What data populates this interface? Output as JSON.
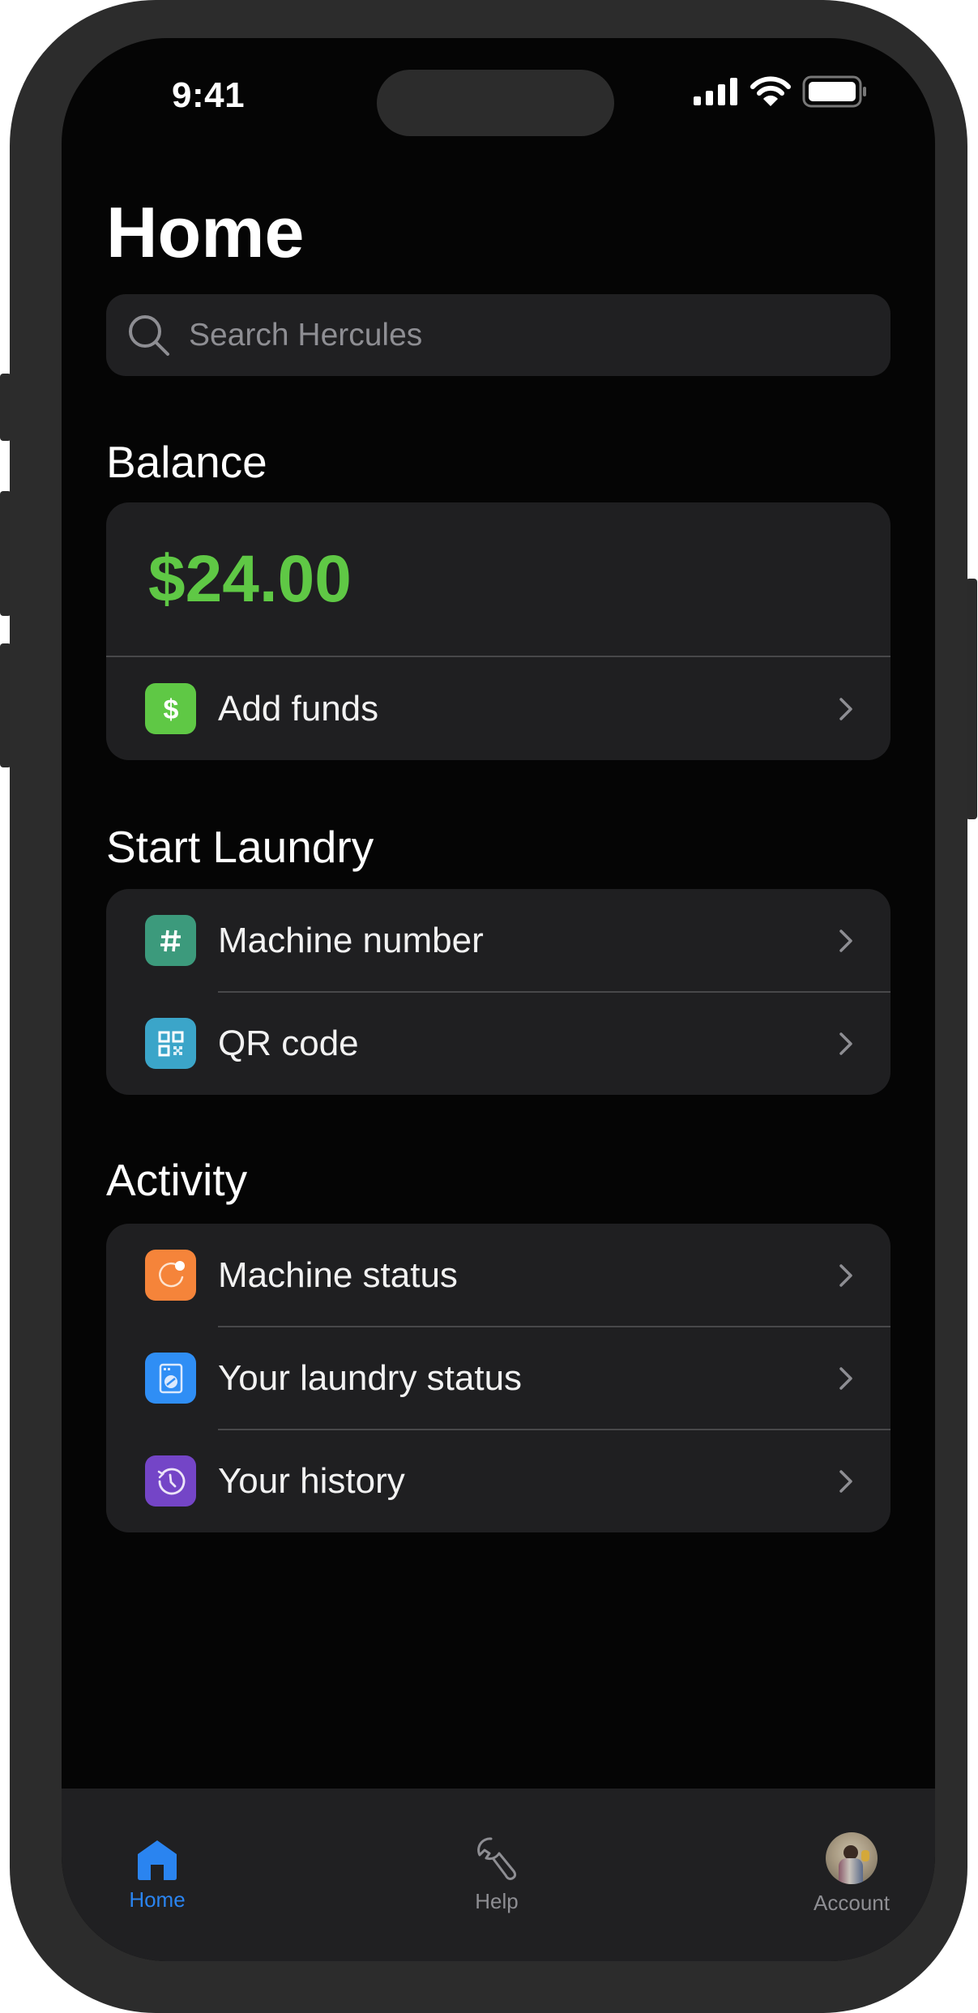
{
  "status_bar": {
    "time": "9:41",
    "icons": [
      "cellular-signal-icon",
      "wifi-icon",
      "battery-icon"
    ]
  },
  "page": {
    "title": "Home"
  },
  "search": {
    "placeholder": "Search Hercules",
    "value": ""
  },
  "balance": {
    "heading": "Balance",
    "amount": "$24.00",
    "amount_color": "#5fc845",
    "add_funds": {
      "label": "Add funds",
      "icon": "dollar-icon",
      "icon_color": "#5fc845"
    }
  },
  "start_laundry": {
    "heading": "Start Laundry",
    "items": [
      {
        "label": "Machine number",
        "icon": "hash-icon",
        "icon_color": "#3c9a7c"
      },
      {
        "label": "QR code",
        "icon": "qr-code-icon",
        "icon_color": "#3ba5c9"
      }
    ]
  },
  "activity": {
    "heading": "Activity",
    "items": [
      {
        "label": "Machine status",
        "icon": "status-ring-icon",
        "icon_color": "#f5843a"
      },
      {
        "label": "Your laundry status",
        "icon": "washing-machine-icon",
        "icon_color": "#2f8ef5"
      },
      {
        "label": "Your history",
        "icon": "history-clock-icon",
        "icon_color": "#7445c7"
      }
    ]
  },
  "tab_bar": {
    "active_color": "#2a84f0",
    "inactive_color": "#8e8e93",
    "tabs": [
      {
        "label": "Home",
        "icon": "home-icon",
        "active": true
      },
      {
        "label": "Help",
        "icon": "wrench-icon",
        "active": false
      },
      {
        "label": "Account",
        "icon": "avatar",
        "active": false
      }
    ]
  }
}
